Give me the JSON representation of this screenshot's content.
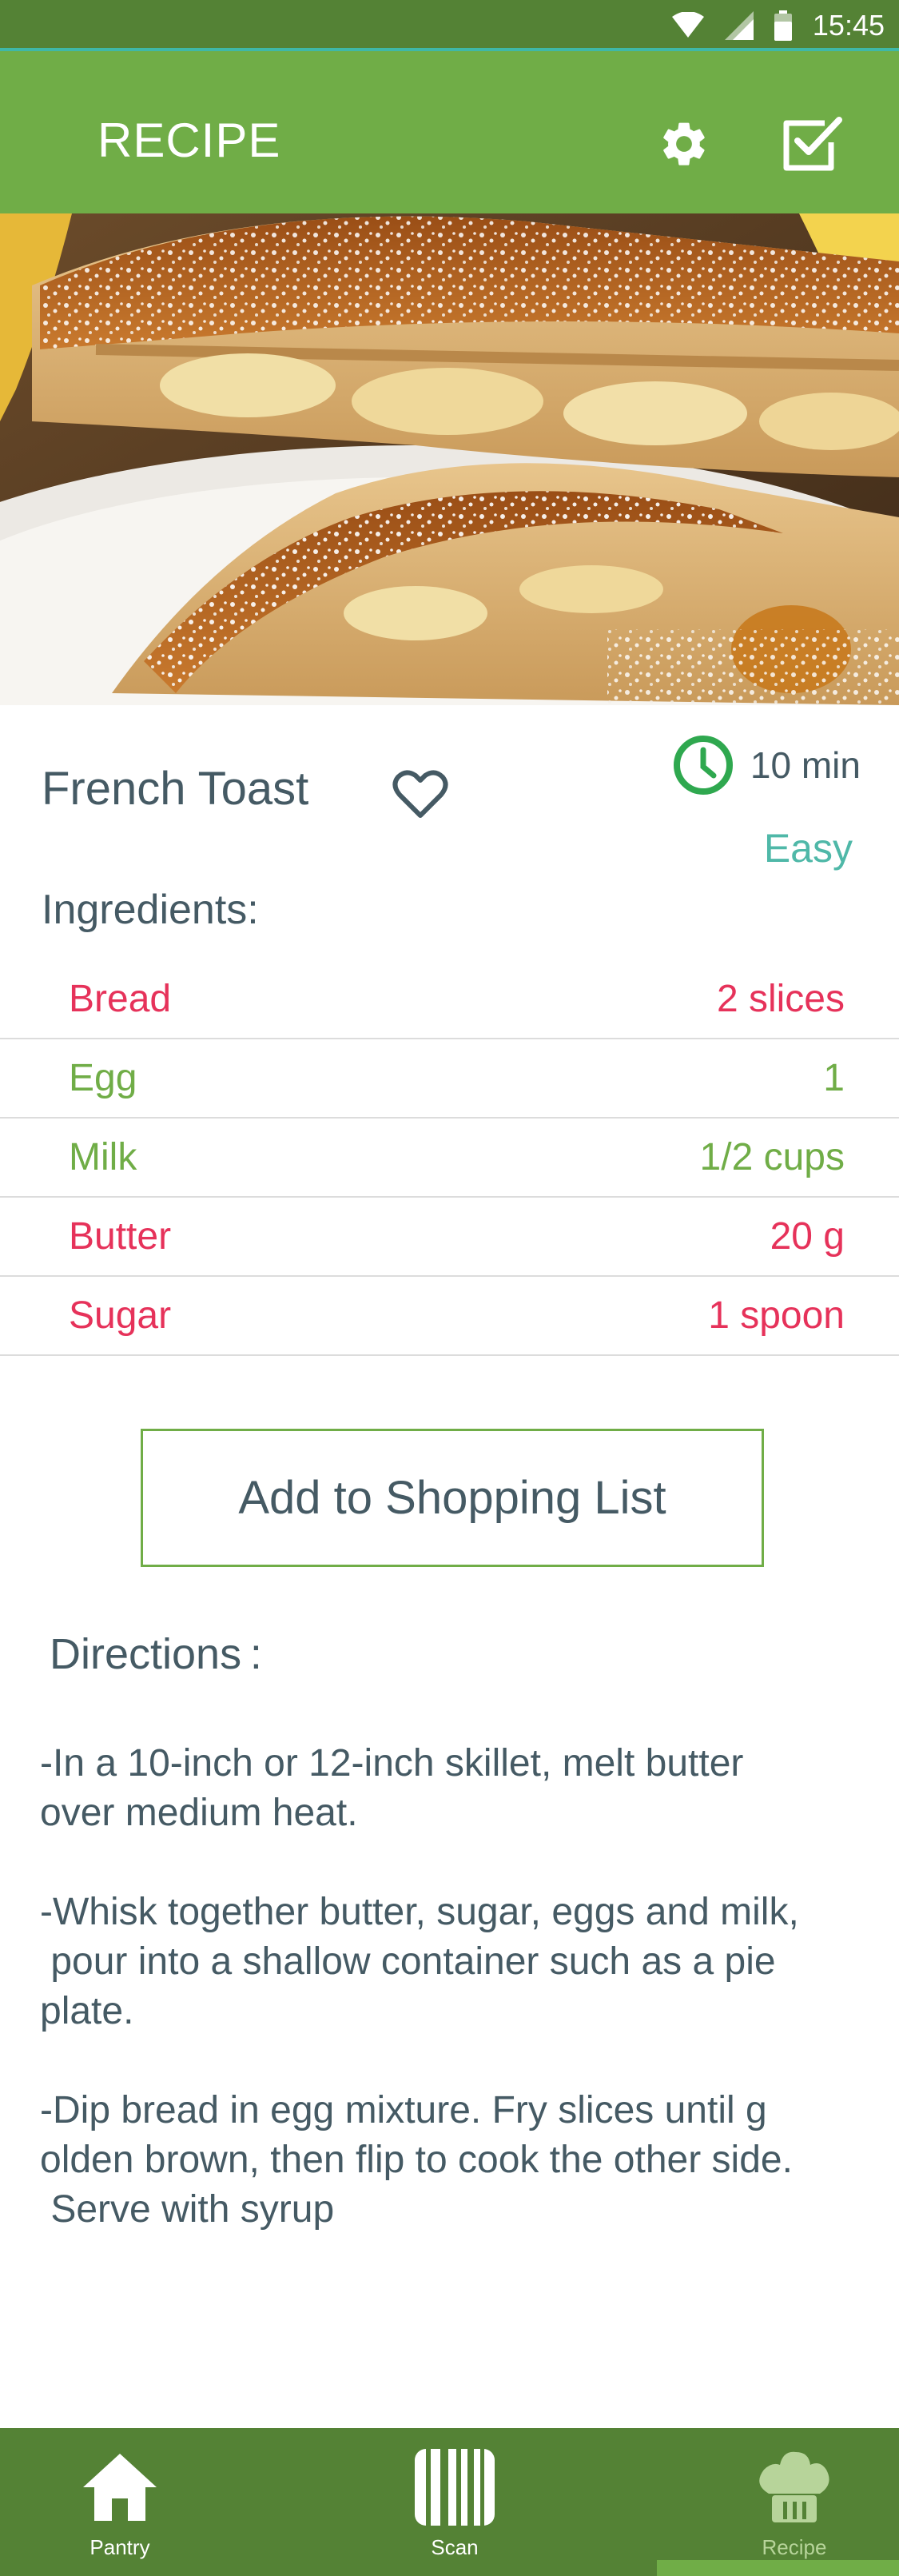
{
  "status_bar": {
    "time": "15:45",
    "icons": [
      "wifi-icon",
      "signal-icon",
      "battery-icon"
    ]
  },
  "app_bar": {
    "title": "RECIPE",
    "actions": [
      "gear-icon",
      "checkbox-icon"
    ]
  },
  "recipe": {
    "name": "French Toast",
    "favorite_icon": "heart-outline-icon",
    "time": "10 min",
    "difficulty": "Easy",
    "ingredients_label": "Ingredients:",
    "ingredients": [
      {
        "name": "Bread",
        "amount": "2 slices",
        "color": "#e6325a"
      },
      {
        "name": "Egg",
        "amount": "1",
        "color": "#70ad47"
      },
      {
        "name": "Milk",
        "amount": "1/2 cups",
        "color": "#70ad47"
      },
      {
        "name": "Butter",
        "amount": "20 g",
        "color": "#e6325a"
      },
      {
        "name": "Sugar",
        "amount": "1 spoon",
        "color": "#e6325a"
      }
    ],
    "add_button_label": "Add to Shopping List",
    "directions_label": "Directions :",
    "directions": [
      "-In a 10-inch or 12-inch skillet, melt butter\nover medium heat.",
      "-Whisk together butter, sugar, eggs and milk,\n pour into a shallow container such as a pie\nplate.",
      "-Dip bread in egg mixture. Fry slices until g\nolden brown, then flip to cook the other side.\n Serve with syrup"
    ]
  },
  "bottom_nav": {
    "items": [
      {
        "label": "Pantry",
        "icon": "house-icon"
      },
      {
        "label": "Scan",
        "icon": "barcode-icon"
      },
      {
        "label": "Recipe",
        "icon": "chef-hat-icon",
        "active": true
      }
    ]
  },
  "colors": {
    "primary": "#70ad47",
    "primary_dark": "#548235",
    "accent_red": "#e6325a",
    "accent_teal": "#4fb8a8",
    "text": "#455a64"
  }
}
